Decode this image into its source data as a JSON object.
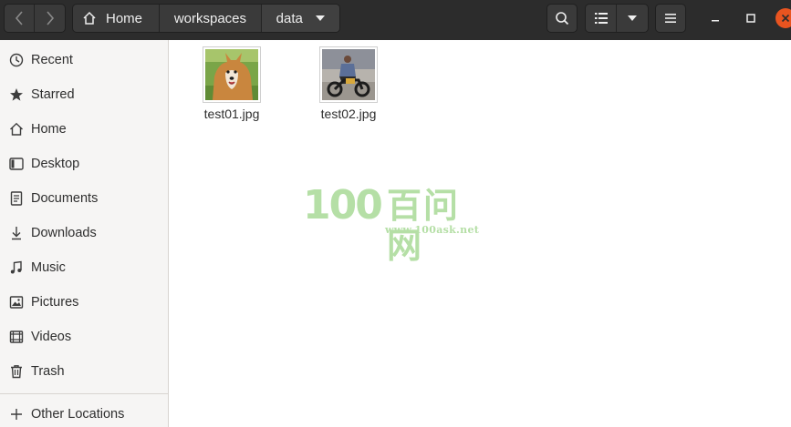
{
  "header": {
    "path": [
      {
        "label": "Home"
      },
      {
        "label": "workspaces"
      },
      {
        "label": "data"
      }
    ]
  },
  "sidebar": {
    "items": [
      {
        "label": "Recent",
        "icon": "clock-icon"
      },
      {
        "label": "Starred",
        "icon": "star-icon"
      },
      {
        "label": "Home",
        "icon": "home-icon"
      },
      {
        "label": "Desktop",
        "icon": "desktop-icon"
      },
      {
        "label": "Documents",
        "icon": "document-icon"
      },
      {
        "label": "Downloads",
        "icon": "download-icon"
      },
      {
        "label": "Music",
        "icon": "music-icon"
      },
      {
        "label": "Pictures",
        "icon": "picture-icon"
      },
      {
        "label": "Videos",
        "icon": "video-icon"
      },
      {
        "label": "Trash",
        "icon": "trash-icon"
      }
    ],
    "other_locations": {
      "label": "Other Locations",
      "icon": "plus-icon"
    }
  },
  "files": [
    {
      "name": "test01.jpg",
      "thumbnail": "dog-photo"
    },
    {
      "name": "test02.jpg",
      "thumbnail": "motorcycle-rider-photo"
    }
  ],
  "watermark": {
    "number": "100",
    "chinese": "百问网",
    "url": "www.100ask.net"
  },
  "colors": {
    "headerbar": "#2c2c2c",
    "sidebar": "#f6f5f4",
    "close_button": "#e95420",
    "watermark": "#b5dfa6"
  }
}
